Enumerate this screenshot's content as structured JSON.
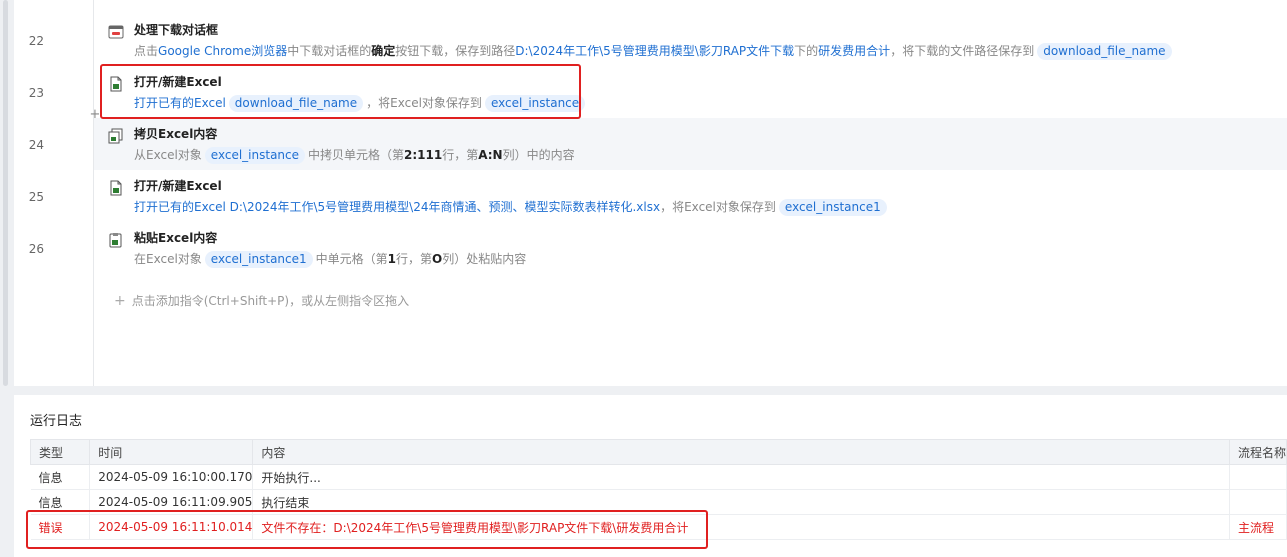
{
  "line_numbers": [
    "22",
    "23",
    "24",
    "25",
    "26"
  ],
  "steps": [
    {
      "title": "处理下载对话框",
      "desc": {
        "p1": "点击",
        "p2": "Google Chrome浏览器",
        "p3": "中下载对话框的",
        "p4": "确定",
        "p5": "按钮下载，保存到路径",
        "p6": "D:\\2024年工作\\5号管理费用模型\\影刀RAP文件下载",
        "p7": "下的",
        "p8": "研发费用合计",
        "p9": "，将下载的文件路径保存到",
        "var": "download_file_name"
      }
    },
    {
      "title": "打开/新建Excel",
      "desc": {
        "p1": "打开已有的Excel",
        "var1": "download_file_name",
        "p2": "，将Excel对象保存到",
        "var2": "excel_instance"
      }
    },
    {
      "title": "拷贝Excel内容",
      "desc": {
        "p1": "从Excel对象",
        "var": "excel_instance",
        "p2": "中拷贝单元格（第",
        "p3": "2:111",
        "p4": "行，第",
        "p5": "A:N",
        "p6": "列）中的内容"
      }
    },
    {
      "title": "打开/新建Excel",
      "desc": {
        "p1": "打开已有的Excel",
        "p2": "D:\\2024年工作\\5号管理费用模型\\24年商情通、预测、模型实际数表样转化.xlsx",
        "p3": "，将Excel对象保存到",
        "var": "excel_instance1"
      }
    },
    {
      "title": "粘贴Excel内容",
      "desc": {
        "p1": "在Excel对象",
        "var": "excel_instance1",
        "p2": "中单元格（第",
        "p3": "1",
        "p4": "行，第",
        "p5": "O",
        "p6": "列）处粘贴内容"
      }
    }
  ],
  "add_command_text": "点击添加指令(Ctrl+Shift+P)，或从左侧指令区拖入",
  "log": {
    "title": "运行日志",
    "headers": {
      "type": "类型",
      "time": "时间",
      "content": "内容",
      "flow": "流程名称"
    },
    "rows": [
      {
        "type": "信息",
        "time": "2024-05-09 16:10:00.170",
        "content": "开始执行...",
        "flow": ""
      },
      {
        "type": "信息",
        "time": "2024-05-09 16:11:09.905",
        "content": "执行结束",
        "flow": ""
      },
      {
        "type": "错误",
        "time": "2024-05-09 16:11:10.014",
        "content": "文件不存在：D:\\2024年工作\\5号管理费用模型\\影刀RAP文件下载\\研发费用合计",
        "flow": "主流程"
      }
    ]
  },
  "colors": {
    "accent": "#1f6fd1",
    "error": "#e02020",
    "chip_bg": "#e8f1fd"
  }
}
